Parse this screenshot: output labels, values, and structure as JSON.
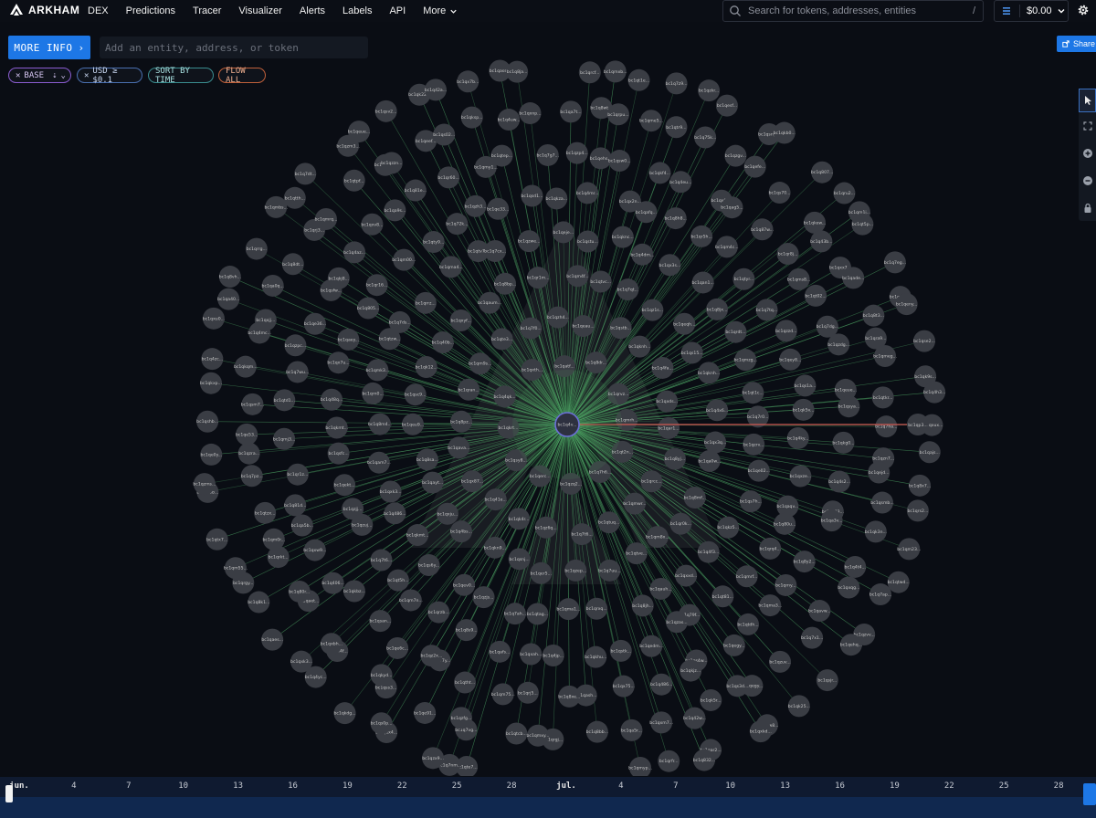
{
  "brand": {
    "name": "ARKHAM"
  },
  "nav": {
    "items": [
      "DEX",
      "Predictions",
      "Tracer",
      "Visualizer",
      "Alerts",
      "Labels",
      "API"
    ],
    "more_label": "More"
  },
  "search": {
    "placeholder": "Search for tokens, addresses, entities",
    "shortcut": "/"
  },
  "wallet": {
    "amount": "$0.00"
  },
  "toolbar": {
    "more_info_label": "MORE INFO",
    "entity_placeholder": "Add an entity, address, or token",
    "share_label": "Share"
  },
  "filters": {
    "base_label": "BASE",
    "usd_label": "USD ≥ $0.1",
    "sort_label": "SORT BY TIME",
    "flow_label": "FLOW ALL"
  },
  "graph": {
    "center_label": "bc1q4v...",
    "outlier_label": "bc1qp3...",
    "node_prefixes": [
      "bc1qk",
      "bc1q4",
      "bc1qx",
      "bc1qa",
      "bc1q8",
      "bc1qr",
      "bc1qm",
      "bc1qt",
      "bc1q7",
      "bc1qz",
      "bc1qe",
      "bc1qs"
    ],
    "colors": {
      "background": "#0a0d14",
      "node": "#3a3d44",
      "inflow_edge": "#4fa866",
      "outflow_edge": "#d05a52",
      "center_ring": "#6b6fd8"
    }
  },
  "timeline": {
    "ticks": [
      "jun.",
      "4",
      "7",
      "10",
      "13",
      "16",
      "19",
      "22",
      "25",
      "28",
      "jul.",
      "4",
      "7",
      "10",
      "13",
      "16",
      "19",
      "22",
      "25",
      "28"
    ]
  },
  "tools": [
    "pointer-icon",
    "fit-screen-icon",
    "zoom-in-icon",
    "zoom-out-icon",
    "lock-icon"
  ]
}
